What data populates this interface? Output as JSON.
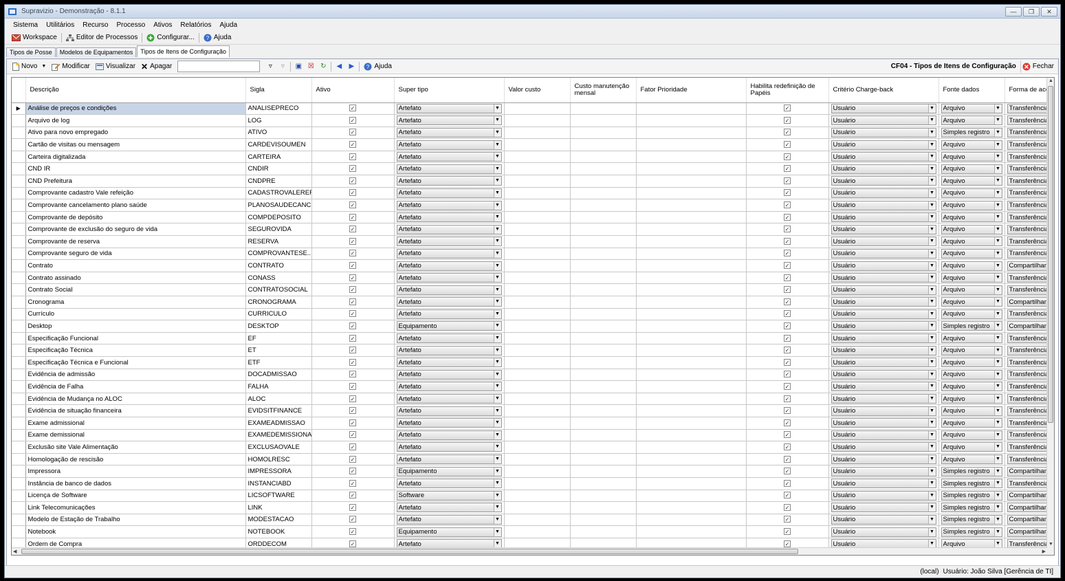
{
  "window": {
    "title": "Supravizio - Demonstração - 8.1.1"
  },
  "menu": [
    "Sistema",
    "Utilitários",
    "Recurso",
    "Processo",
    "Ativos",
    "Relatórios",
    "Ajuda"
  ],
  "main_toolbar": {
    "workspace": "Workspace",
    "editor": "Editor de Processos",
    "configurar": "Configurar...",
    "ajuda": "Ajuda"
  },
  "doc_tabs": [
    "Tipos de Posse",
    "Modelos de Equipamentos",
    "Tipos de Itens de Configuração"
  ],
  "grid_toolbar": {
    "novo": "Novo",
    "modificar": "Modificar",
    "visualizar": "Visualizar",
    "apagar": "Apagar",
    "search_value": "",
    "ajuda": "Ajuda",
    "form_title": "CF04 - Tipos de Itens de Configuração",
    "fechar": "Fechar"
  },
  "columns": [
    "Descrição",
    "Sigla",
    "Ativo",
    "Super tipo",
    "Valor custo",
    "Custo manutenção mensal",
    "Fator Prioridade",
    "Habilita redefinição de Papéis",
    "Critério Charge-back",
    "Fonte dados",
    "Forma de acesso"
  ],
  "rows": [
    {
      "desc": "Análise de preços e condições",
      "sigla": "ANALISEPRECO",
      "super": "Artefato",
      "crit": "Usuário",
      "fonte": "Arquivo",
      "forma": "Transferência"
    },
    {
      "desc": "Arquivo de log",
      "sigla": "LOG",
      "super": "Artefato",
      "crit": "Usuário",
      "fonte": "Arquivo",
      "forma": "Transferência"
    },
    {
      "desc": "Ativo para novo empregado",
      "sigla": "ATIVO",
      "super": "Artefato",
      "crit": "Usuário",
      "fonte": "Simples registro",
      "forma": "Transferência"
    },
    {
      "desc": "Cartão de visitas ou mensagem",
      "sigla": "CARDEVISOUMEN",
      "super": "Artefato",
      "crit": "Usuário",
      "fonte": "Arquivo",
      "forma": "Transferência"
    },
    {
      "desc": "Carteira digitalizada",
      "sigla": "CARTEIRA",
      "super": "Artefato",
      "crit": "Usuário",
      "fonte": "Arquivo",
      "forma": "Transferência"
    },
    {
      "desc": "CND IR",
      "sigla": "CNDIR",
      "super": "Artefato",
      "crit": "Usuário",
      "fonte": "Arquivo",
      "forma": "Transferência"
    },
    {
      "desc": "CND Prefeitura",
      "sigla": "CNDPRE",
      "super": "Artefato",
      "crit": "Usuário",
      "fonte": "Arquivo",
      "forma": "Transferência"
    },
    {
      "desc": "Comprovante cadastro Vale refeição",
      "sigla": "CADASTROVALEREF",
      "super": "Artefato",
      "crit": "Usuário",
      "fonte": "Arquivo",
      "forma": "Transferência"
    },
    {
      "desc": "Comprovante cancelamento plano saúde",
      "sigla": "PLANOSAUDECANC",
      "super": "Artefato",
      "crit": "Usuário",
      "fonte": "Arquivo",
      "forma": "Transferência"
    },
    {
      "desc": "Comprovante de depósito",
      "sigla": "COMPDEPOSITO",
      "super": "Artefato",
      "crit": "Usuário",
      "fonte": "Arquivo",
      "forma": "Transferência"
    },
    {
      "desc": "Comprovante de exclusão do seguro de vida",
      "sigla": "SEGUROVIDA",
      "super": "Artefato",
      "crit": "Usuário",
      "fonte": "Arquivo",
      "forma": "Transferência"
    },
    {
      "desc": "Comprovante de reserva",
      "sigla": "RESERVA",
      "super": "Artefato",
      "crit": "Usuário",
      "fonte": "Arquivo",
      "forma": "Transferência"
    },
    {
      "desc": "Comprovante seguro de vida",
      "sigla": "COMPROVANTESE...",
      "super": "Artefato",
      "crit": "Usuário",
      "fonte": "Arquivo",
      "forma": "Transferência"
    },
    {
      "desc": "Contrato",
      "sigla": "CONTRATO",
      "super": "Artefato",
      "crit": "Usuário",
      "fonte": "Arquivo",
      "forma": "Compartilhament"
    },
    {
      "desc": "Contrato assinado",
      "sigla": "CONASS",
      "super": "Artefato",
      "crit": "Usuário",
      "fonte": "Arquivo",
      "forma": "Transferência"
    },
    {
      "desc": "Contrato Social",
      "sigla": "CONTRATOSOCIAL",
      "super": "Artefato",
      "crit": "Usuário",
      "fonte": "Arquivo",
      "forma": "Transferência"
    },
    {
      "desc": "Cronograma",
      "sigla": "CRONOGRAMA",
      "super": "Artefato",
      "crit": "Usuário",
      "fonte": "Arquivo",
      "forma": "Compartilhament"
    },
    {
      "desc": "Currículo",
      "sigla": "CURRICULO",
      "super": "Artefato",
      "crit": "Usuário",
      "fonte": "Arquivo",
      "forma": "Transferência"
    },
    {
      "desc": "Desktop",
      "sigla": "DESKTOP",
      "super": "Equipamento",
      "crit": "Usuário",
      "fonte": "Simples registro",
      "forma": "Compartilhament"
    },
    {
      "desc": "Especificação Funcional",
      "sigla": "EF",
      "super": "Artefato",
      "crit": "Usuário",
      "fonte": "Arquivo",
      "forma": "Transferência"
    },
    {
      "desc": "Especificação Técnica",
      "sigla": "ET",
      "super": "Artefato",
      "crit": "Usuário",
      "fonte": "Arquivo",
      "forma": "Transferência"
    },
    {
      "desc": "Especificação Técnica e Funcional",
      "sigla": "ETF",
      "super": "Artefato",
      "crit": "Usuário",
      "fonte": "Arquivo",
      "forma": "Transferência"
    },
    {
      "desc": "Evidência de admissão",
      "sigla": "DOCADMISSAO",
      "super": "Artefato",
      "crit": "Usuário",
      "fonte": "Arquivo",
      "forma": "Transferência"
    },
    {
      "desc": "Evidência de Falha",
      "sigla": "FALHA",
      "super": "Artefato",
      "crit": "Usuário",
      "fonte": "Arquivo",
      "forma": "Transferência"
    },
    {
      "desc": "Evidência de Mudança no ALOC",
      "sigla": "ALOC",
      "super": "Artefato",
      "crit": "Usuário",
      "fonte": "Arquivo",
      "forma": "Transferência"
    },
    {
      "desc": "Evidência de situação financeira",
      "sigla": "EVIDSITFINANCE",
      "super": "Artefato",
      "crit": "Usuário",
      "fonte": "Arquivo",
      "forma": "Transferência"
    },
    {
      "desc": "Exame admissional",
      "sigla": "EXAMEADMISSAO",
      "super": "Artefato",
      "crit": "Usuário",
      "fonte": "Arquivo",
      "forma": "Transferência"
    },
    {
      "desc": "Exame demissional",
      "sigla": "EXAMEDEMISSIONAL",
      "super": "Artefato",
      "crit": "Usuário",
      "fonte": "Arquivo",
      "forma": "Transferência"
    },
    {
      "desc": "Exclusão site Vale Alimentação",
      "sigla": "EXCLUSAOVALE",
      "super": "Artefato",
      "crit": "Usuário",
      "fonte": "Arquivo",
      "forma": "Transferência"
    },
    {
      "desc": "Homologação de rescisão",
      "sigla": "HOMOLRESC",
      "super": "Artefato",
      "crit": "Usuário",
      "fonte": "Arquivo",
      "forma": "Transferência"
    },
    {
      "desc": "Impressora",
      "sigla": "IMPRESSORA",
      "super": "Equipamento",
      "crit": "Usuário",
      "fonte": "Simples registro",
      "forma": "Compartilhament"
    },
    {
      "desc": "Instância de banco de dados",
      "sigla": "INSTANCIABD",
      "super": "Artefato",
      "crit": "Usuário",
      "fonte": "Simples registro",
      "forma": "Transferência"
    },
    {
      "desc": "Licença de Software",
      "sigla": "LICSOFTWARE",
      "super": "Software",
      "crit": "Usuário",
      "fonte": "Simples registro",
      "forma": "Compartilhament"
    },
    {
      "desc": "Link Telecomunicações",
      "sigla": "LINK",
      "super": "Artefato",
      "crit": "Usuário",
      "fonte": "Simples registro",
      "forma": "Compartilhament"
    },
    {
      "desc": "Modelo de Estação de Trabalho",
      "sigla": "MODESTACAO",
      "super": "Artefato",
      "crit": "Usuário",
      "fonte": "Simples registro",
      "forma": "Compartilhament"
    },
    {
      "desc": "Notebook",
      "sigla": "NOTEBOOK",
      "super": "Equipamento",
      "crit": "Usuário",
      "fonte": "Simples registro",
      "forma": "Compartilhament"
    },
    {
      "desc": "Ordem de Compra",
      "sigla": "ORDDECOM",
      "super": "Artefato",
      "crit": "Usuário",
      "fonte": "Arquivo",
      "forma": "Transferência"
    }
  ],
  "status": {
    "server": "(local)",
    "user": "Usuário: João Silva [Gerência de TI]"
  }
}
